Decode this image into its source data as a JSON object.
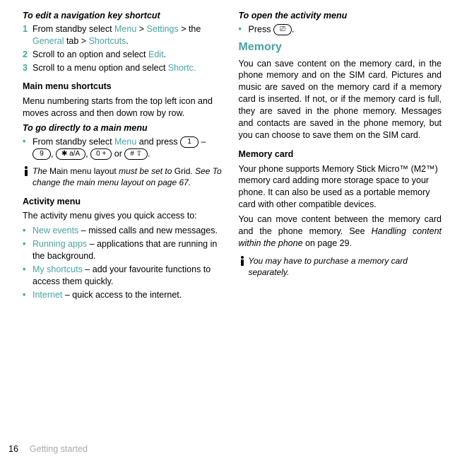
{
  "left": {
    "editShortcutHeading": "To edit a navigation key shortcut",
    "step1_pre": "From standby select ",
    "menu": "Menu",
    "gt": " > ",
    "settings": "Settings",
    "step1_mid": " > the ",
    "general": "General",
    "step1_tab": " tab > ",
    "shortcuts": "Shortcuts",
    "period": ".",
    "step2_pre": "Scroll to an option and select ",
    "edit": "Edit",
    "step3_pre": "Scroll to a menu option and select ",
    "shortc": "Shortc.",
    "mainMenuShortcuts": "Main menu shortcuts",
    "mainMenuPara": "Menu numbering starts from the top left icon and moves across and then down row by row.",
    "goDirectHeading": "To go directly to a main menu",
    "goDirect_pre": "From standby select ",
    "goDirect_post": " and press ",
    "dash": " – ",
    "comma": ", ",
    "or": " or ",
    "key1": "1",
    "key9": "9",
    "keyStar": "✱ a/A",
    "key0": "0 +",
    "keyHash": "# ⇧",
    "note1_a": "The ",
    "note1_b": "Main menu layout",
    "note1_c": " must be set to ",
    "note1_d": "Grid",
    "note1_e": ". See To change the main menu layout on page 67.",
    "activityMenu": "Activity menu",
    "activityPara": "The activity menu gives you quick access to:",
    "b1_label": "New events",
    "b1_rest": " – missed calls and new messages.",
    "b2_label": "Running apps",
    "b2_rest": " – applications that are running in the background.",
    "b3_label": "My shortcuts",
    "b3_rest": " – add your favourite functions to access them quickly.",
    "b4_label": "Internet",
    "b4_rest": " – quick access to the internet."
  },
  "right": {
    "openActivityHeading": "To open the activity menu",
    "press": "Press ",
    "activityKey": "⎚",
    "memoryTitle": "Memory",
    "memoryPara": "You can save content on the memory card, in the phone memory and on the SIM card. Pictures and music are saved on the memory card if a memory card is inserted. If not, or if the memory card is full, they are saved in the phone memory. Messages and contacts are saved in the phone memory, but you can choose to save them on the SIM card.",
    "memoryCardHead": "Memory card",
    "memoryCardPara1": "Your phone supports Memory Stick Micro™ (M2™) memory card adding more storage space to your phone. It can also be used as a portable memory card with other compatible devices.",
    "memoryCardPara2_a": "You can move content between the memory card and the phone memory. See ",
    "memoryCardPara2_b": "Handling content within the phone",
    "memoryCardPara2_c": " on page 29.",
    "note2": "You may have to purchase a memory card separately."
  },
  "footer": {
    "page": "16",
    "section": "Getting started"
  }
}
